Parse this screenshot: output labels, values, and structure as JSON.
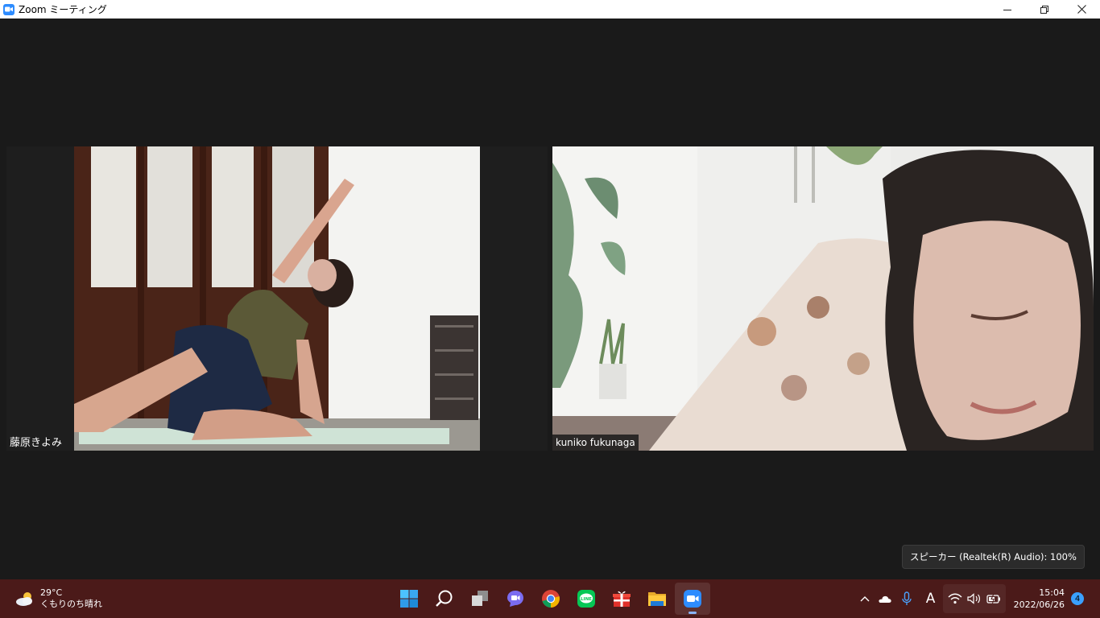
{
  "window": {
    "title": "Zoom ミーティング"
  },
  "participants": [
    {
      "name": "藤原きよみ"
    },
    {
      "name": "kuniko fukunaga"
    }
  ],
  "tooltip": {
    "text": "スピーカー (Realtek(R) Audio): 100%"
  },
  "taskbar": {
    "weather": {
      "temp": "29°C",
      "desc": "くもりのち晴れ",
      "icon": "partly-cloudy-icon"
    },
    "apps": [
      {
        "name": "start",
        "icon": "windows-start-icon"
      },
      {
        "name": "search",
        "icon": "search-icon"
      },
      {
        "name": "task-view",
        "icon": "task-view-icon"
      },
      {
        "name": "teams-chat",
        "icon": "chat-icon"
      },
      {
        "name": "chrome",
        "icon": "chrome-icon"
      },
      {
        "name": "line",
        "icon": "line-icon"
      },
      {
        "name": "gift",
        "icon": "gift-icon"
      },
      {
        "name": "file-explorer",
        "icon": "folder-icon"
      },
      {
        "name": "zoom",
        "icon": "zoom-icon",
        "active": true
      }
    ],
    "tray": {
      "ime_label": "A",
      "time": "15:04",
      "date": "2022/06/26",
      "notification_count": "4"
    }
  },
  "colors": {
    "accent": "#2d8cff",
    "taskbar": "#4b1a19",
    "meeting_bg": "#1a1a1a"
  }
}
